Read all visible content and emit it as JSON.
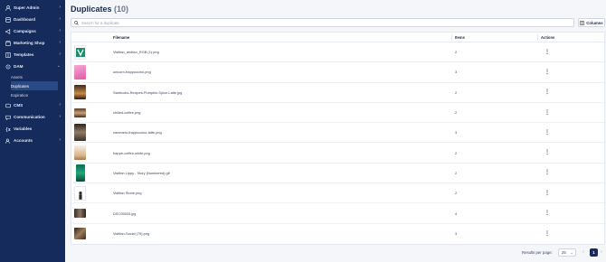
{
  "sidebar": {
    "items": [
      {
        "label": "Super Admin",
        "icon": "super-admin-icon"
      },
      {
        "label": "Dashboard",
        "icon": "dashboard-icon"
      },
      {
        "label": "Campaigns",
        "icon": "campaigns-icon"
      },
      {
        "label": "Marketing Shop",
        "icon": "shop-icon"
      },
      {
        "label": "Templates",
        "icon": "templates-icon"
      },
      {
        "label": "DAM",
        "icon": "dam-icon"
      },
      {
        "label": "CMS",
        "icon": "cms-icon"
      },
      {
        "label": "Communication",
        "icon": "communication-icon"
      },
      {
        "label": "Variables",
        "icon": "variables-icon"
      },
      {
        "label": "Accounts",
        "icon": "accounts-icon"
      }
    ],
    "dam_sub": [
      "Assets",
      "Duplicates",
      "Expiration"
    ]
  },
  "page": {
    "title": "Duplicates",
    "count": "(10)"
  },
  "search": {
    "placeholder": "Search for a duplicate"
  },
  "columns_label": "Columns",
  "table": {
    "headers": {
      "filename": "Filename",
      "items": "Items",
      "actions": "Actions"
    },
    "rows": [
      {
        "filename": "Visitfan_andfan_RGB (1).png",
        "items": "2"
      },
      {
        "filename": "unicorn-frappuccino.png",
        "items": "3"
      },
      {
        "filename": "Starbucks-Recipes-Pumpkin-Spice-Latte.jpg",
        "items": "2"
      },
      {
        "filename": "chilled-coffee.png",
        "items": "2"
      },
      {
        "filename": "caramelo-frappuccino-latte.png",
        "items": "3"
      },
      {
        "filename": "frappe-coffee-white.png",
        "items": "2"
      },
      {
        "filename": "Visitfan Lippy - Story (Numbered).gif",
        "items": "2"
      },
      {
        "filename": "Visitfan Stone.png",
        "items": "2"
      },
      {
        "filename": "DSC05503.jpg",
        "items": "4"
      },
      {
        "filename": "Visitfan-Social (79).png",
        "items": "3"
      }
    ]
  },
  "pagination": {
    "rpp_label": "Results per page:",
    "rpp_value": "25",
    "page": "1"
  },
  "colors": {
    "sidebar": "#152b5c",
    "accent": "#152b5c"
  }
}
